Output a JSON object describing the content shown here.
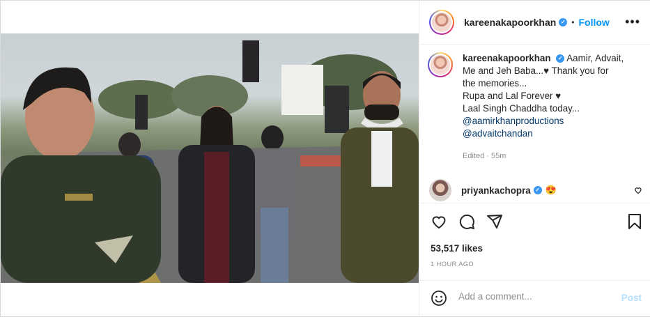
{
  "post": {
    "username": "kareenakapoorkhan",
    "follow_label": "Follow",
    "separator": "•",
    "more_label": "•••",
    "caption_lines": [
      "Aamir, Advait,",
      "Me and Jeh Baba...♥ Thank you for",
      "the memories...",
      "Rupa and Lal Forever ♥",
      "Laal Singh Chaddha today..."
    ],
    "mentions": [
      "@aamirkhanproductions",
      "@advaitchandan"
    ],
    "edited": "Edited · 55m",
    "comment": {
      "username": "priyankachopra",
      "emoji": "😍"
    },
    "likes": "53,517 likes",
    "time_ago": "1 HOUR AGO",
    "add_comment_placeholder": "Add a comment...",
    "post_label": "Post",
    "verified_mark": "✓"
  },
  "icons": [
    "heart-icon",
    "comment-icon",
    "share-icon",
    "save-icon",
    "emoji-icon",
    "verified-icon",
    "more-icon"
  ],
  "colors": {
    "link": "#0095f6",
    "mention": "#00376b",
    "post_disabled": "#b2dffc",
    "verified": "#3897f0"
  }
}
